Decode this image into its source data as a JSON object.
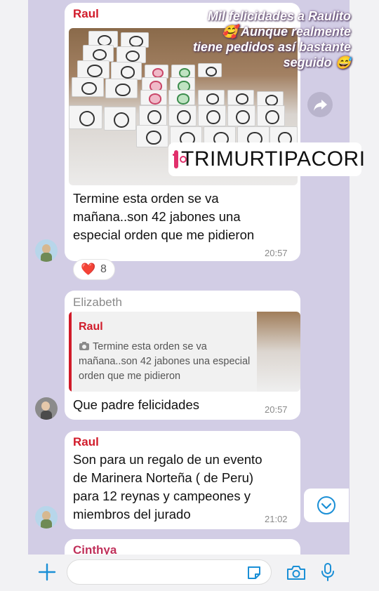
{
  "story": {
    "caption": "Mil felicidades a Raulito 🥰 Aunque realmente tiene pedidos así bastante seguido 😅",
    "instagram_handle": "TRIMURTIPACORI"
  },
  "messages": [
    {
      "sender": "Raul",
      "sender_color": "#d11b2a",
      "text": "Termine esta orden se va mañana..son 42 jabones una especial orden que me pidieron",
      "time": "20:57",
      "reaction": {
        "emoji": "❤️",
        "count": "8"
      }
    },
    {
      "sender": "Elizabeth",
      "sender_color": "#8a8a8a",
      "quote": {
        "sender": "Raul",
        "camera_icon": "camera-icon",
        "text": "Termine esta orden se va mañana..son 42 jabones una especial orden que me pidieron"
      },
      "text": "Que padre felicidades",
      "time": "20:57"
    },
    {
      "sender": "Raul",
      "sender_color": "#d11b2a",
      "text": "Son para un regalo de un evento de Marinera Norteña ( de Peru) para 12 reynas y campeones y miembros del jurado",
      "time": "21:02"
    },
    {
      "sender": "Cinthya",
      "sender_color": "#c0305a"
    }
  ],
  "icons": {
    "forward": "share-forward-icon",
    "scroll_down": "chevron-down-icon",
    "attach": "plus-icon",
    "sticker": "sticker-icon",
    "camera": "camera-icon",
    "mic": "microphone-icon"
  },
  "accent_color": "#1a8fd6"
}
